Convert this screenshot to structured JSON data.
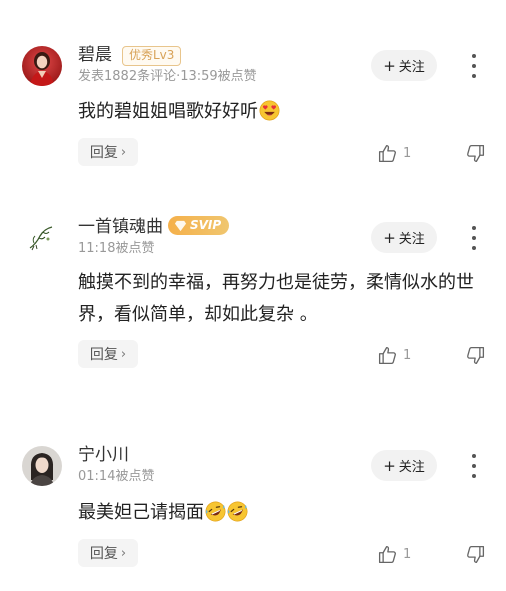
{
  "comments": [
    {
      "username": "碧晨",
      "level_badge": "优秀Lv3",
      "meta": "发表1882条评论·13:59被点赞",
      "text": "我的碧姐姐唱歌好好听",
      "emoji_icons": [
        "heart-eyes-emoji-icon"
      ],
      "follow_label": "关注",
      "reply_label": "回复",
      "like_count": "1"
    },
    {
      "username": "一首镇魂曲",
      "vip_badge": "SVIP",
      "meta": "11:18被点赞",
      "text": "触摸不到的幸福，再努力也是徒劳，柔情似水的世界，看似简单，却如此复杂 。",
      "follow_label": "关注",
      "reply_label": "回复",
      "like_count": "1"
    },
    {
      "username": "宁小川",
      "meta": "01:14被点赞",
      "text": "最美妲己请揭面",
      "emoji_icons": [
        "rofl-emoji-icon",
        "rofl-emoji-icon"
      ],
      "follow_label": "关注",
      "reply_label": "回复",
      "like_count": "1"
    }
  ],
  "colors": {
    "badge_gold": "#d8a257",
    "svip_gold": "#f5b04a",
    "meta_gray": "#999999",
    "button_bg": "#f2f2f2"
  }
}
